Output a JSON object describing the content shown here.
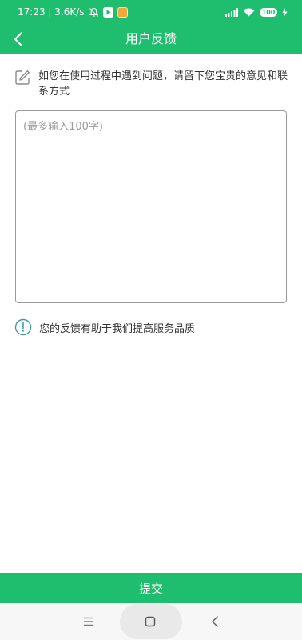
{
  "status_bar": {
    "time_speed": "17:23 | 3.6K/s",
    "battery": "100",
    "icons": [
      "mute-bell-icon",
      "video-app-icon",
      "app-notification-icon",
      "signal-icon",
      "wifi-icon",
      "battery-icon",
      "charging-icon"
    ]
  },
  "header": {
    "title": "用户反馈",
    "back_icon": "back-chevron-icon"
  },
  "hint": {
    "text": "如您在使用过程中遇到问题，请留下您宝贵的意见和联系方式",
    "icon": "edit-icon"
  },
  "feedback": {
    "value": "",
    "placeholder": "(最多输入100字)"
  },
  "note": {
    "text": "您的反馈有助于我们提高服务品质",
    "icon": "info-icon"
  },
  "submit": {
    "label": "提交"
  },
  "colors": {
    "brand_green": "#1fbe6e",
    "text": "#333333",
    "placeholder": "#9b9b9b",
    "info_icon": "#3aa0a8"
  }
}
